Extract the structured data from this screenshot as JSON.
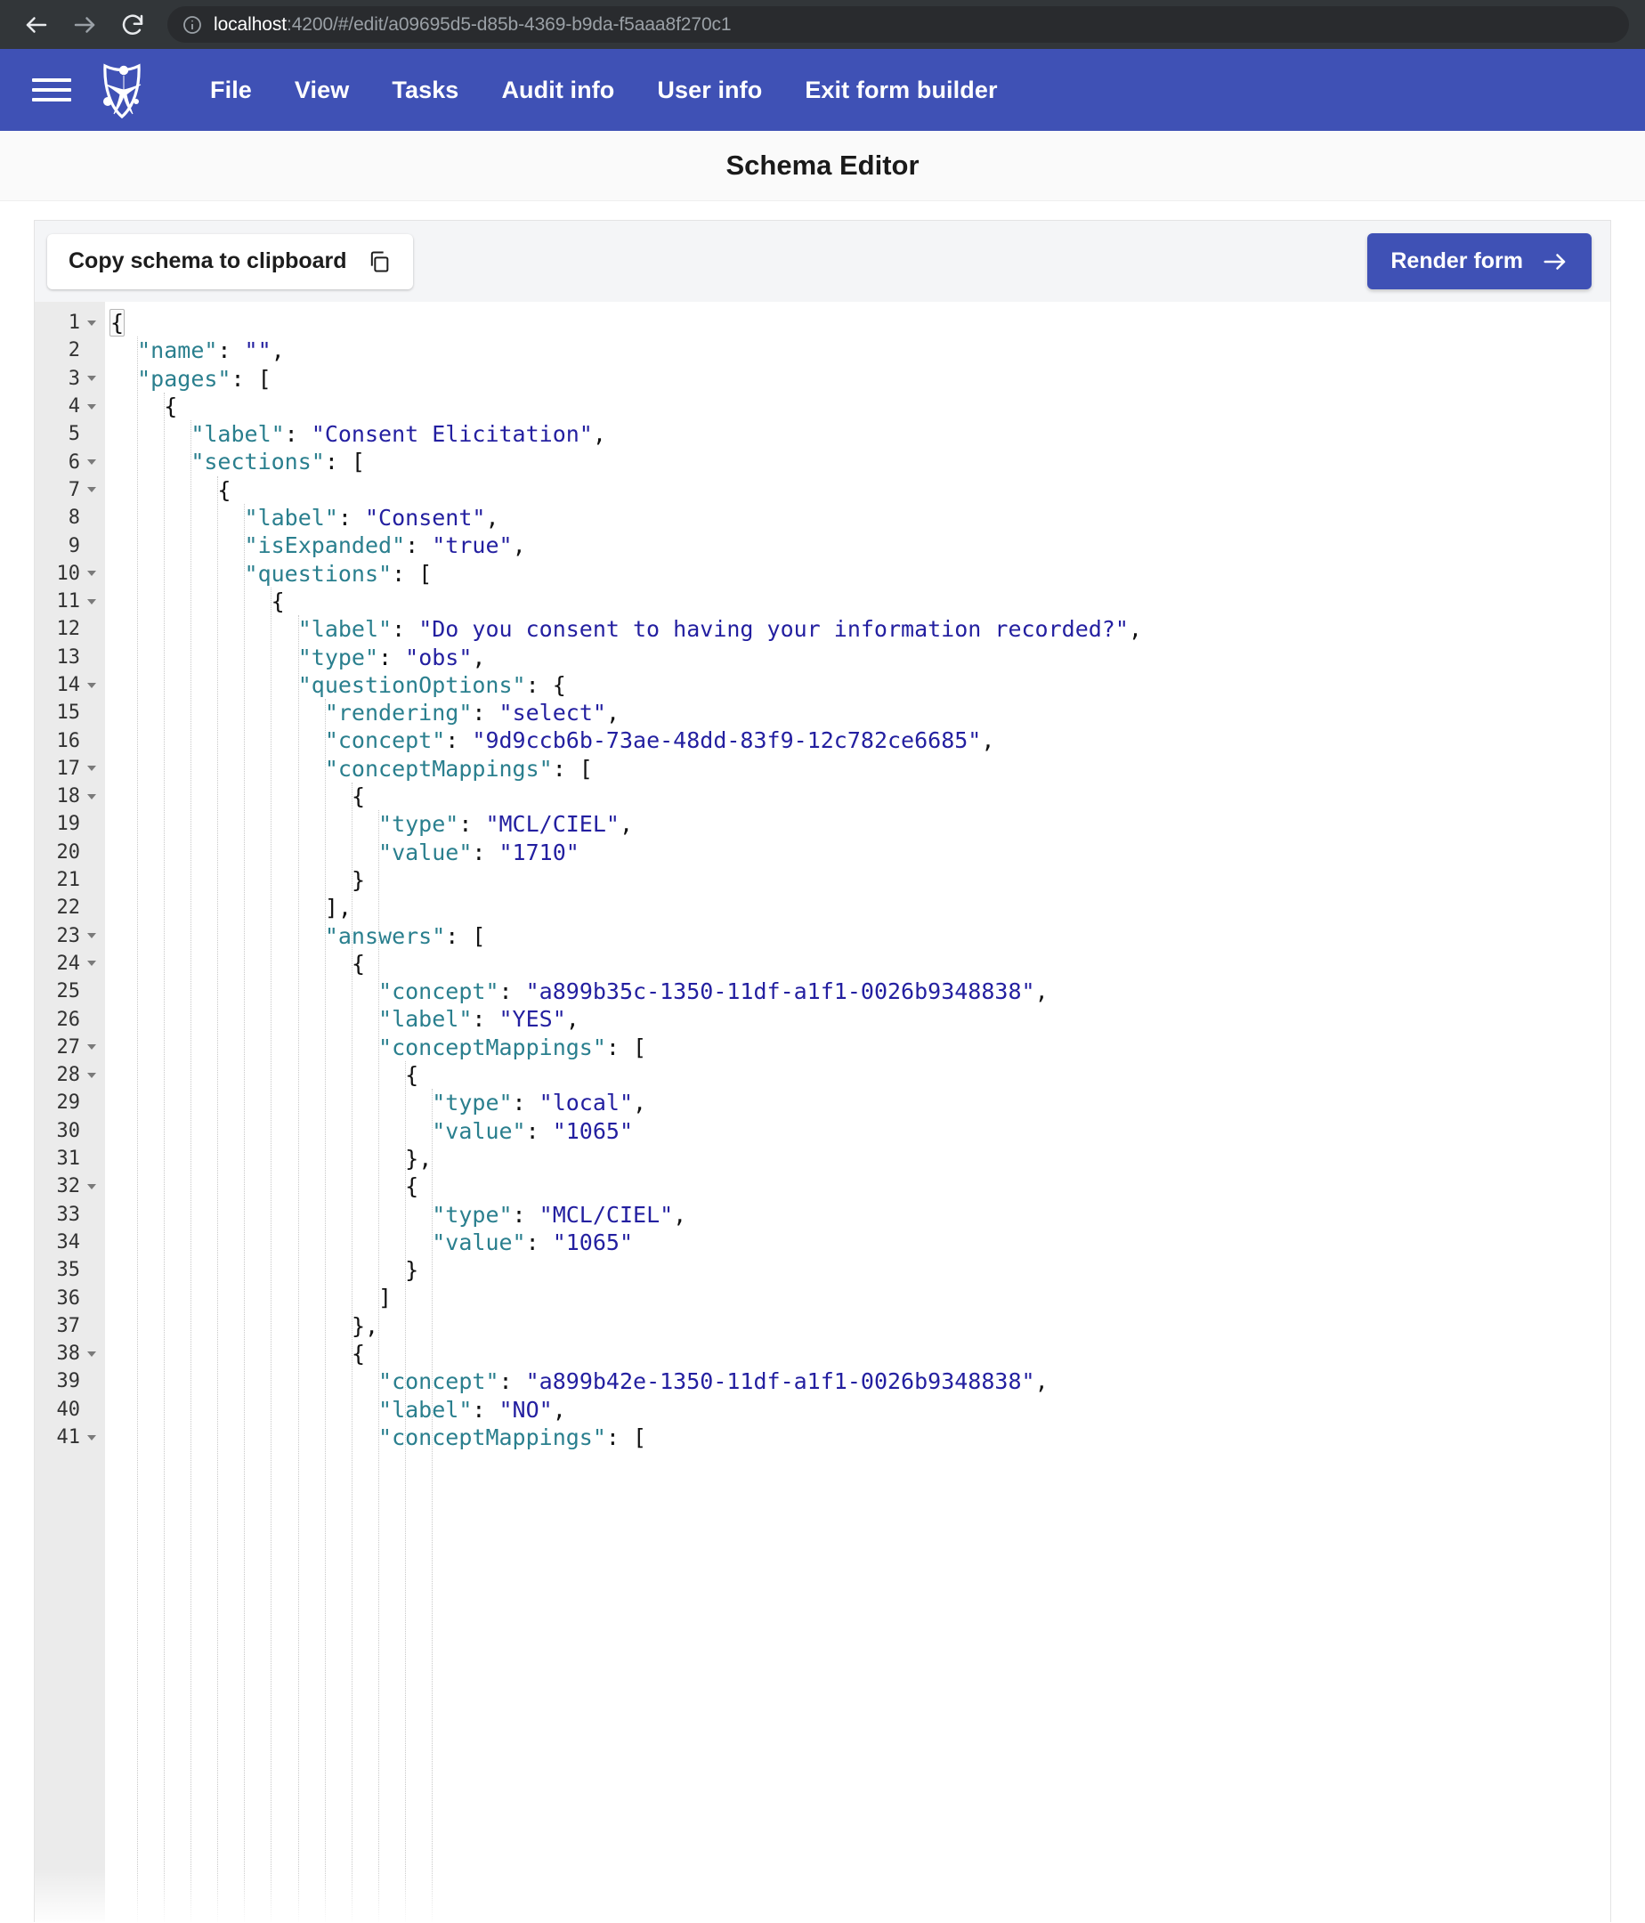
{
  "browser": {
    "back_icon": "back-arrow-icon",
    "forward_icon": "forward-arrow-icon",
    "reload_icon": "reload-icon",
    "info_icon": "site-info-icon",
    "url_host": "localhost",
    "url_path": ":4200/#/edit/a09695d5-d85b-4369-b9da-f5aaa8f270c1"
  },
  "app_nav": {
    "brand": "openmrs-logo",
    "menu_icon": "hamburger-menu-icon",
    "links": [
      {
        "label": "File"
      },
      {
        "label": "View"
      },
      {
        "label": "Tasks"
      },
      {
        "label": "Audit info"
      },
      {
        "label": "User info"
      },
      {
        "label": "Exit form builder"
      }
    ],
    "accent_color": "#3f51b5"
  },
  "header": {
    "title": "Schema Editor"
  },
  "toolbar": {
    "copy_label": "Copy schema to clipboard",
    "copy_icon": "copy-icon",
    "render_label": "Render form",
    "render_icon": "arrow-right-icon"
  },
  "editor": {
    "language": "json",
    "first_visible_line": 1,
    "last_visible_line": 41,
    "colors": {
      "key": "#2a7f8e",
      "string": "#231fa0",
      "punctuation": "#111111",
      "gutter_bg": "#ebebeb",
      "editor_bg": "#ffffff"
    },
    "lines": [
      {
        "n": 1,
        "fold": true,
        "indent": 0,
        "tokens": [
          {
            "t": "punct",
            "v": "{"
          }
        ]
      },
      {
        "n": 2,
        "fold": false,
        "indent": 1,
        "tokens": [
          {
            "t": "key",
            "v": "\"name\""
          },
          {
            "t": "punct",
            "v": ": "
          },
          {
            "t": "str",
            "v": "\"\""
          },
          {
            "t": "punct",
            "v": ","
          }
        ]
      },
      {
        "n": 3,
        "fold": true,
        "indent": 1,
        "tokens": [
          {
            "t": "key",
            "v": "\"pages\""
          },
          {
            "t": "punct",
            "v": ": ["
          }
        ]
      },
      {
        "n": 4,
        "fold": true,
        "indent": 2,
        "tokens": [
          {
            "t": "punct",
            "v": "{"
          }
        ]
      },
      {
        "n": 5,
        "fold": false,
        "indent": 3,
        "tokens": [
          {
            "t": "key",
            "v": "\"label\""
          },
          {
            "t": "punct",
            "v": ": "
          },
          {
            "t": "str",
            "v": "\"Consent Elicitation\""
          },
          {
            "t": "punct",
            "v": ","
          }
        ]
      },
      {
        "n": 6,
        "fold": true,
        "indent": 3,
        "tokens": [
          {
            "t": "key",
            "v": "\"sections\""
          },
          {
            "t": "punct",
            "v": ": ["
          }
        ]
      },
      {
        "n": 7,
        "fold": true,
        "indent": 4,
        "tokens": [
          {
            "t": "punct",
            "v": "{"
          }
        ]
      },
      {
        "n": 8,
        "fold": false,
        "indent": 5,
        "tokens": [
          {
            "t": "key",
            "v": "\"label\""
          },
          {
            "t": "punct",
            "v": ": "
          },
          {
            "t": "str",
            "v": "\"Consent\""
          },
          {
            "t": "punct",
            "v": ","
          }
        ]
      },
      {
        "n": 9,
        "fold": false,
        "indent": 5,
        "tokens": [
          {
            "t": "key",
            "v": "\"isExpanded\""
          },
          {
            "t": "punct",
            "v": ": "
          },
          {
            "t": "str",
            "v": "\"true\""
          },
          {
            "t": "punct",
            "v": ","
          }
        ]
      },
      {
        "n": 10,
        "fold": true,
        "indent": 5,
        "tokens": [
          {
            "t": "key",
            "v": "\"questions\""
          },
          {
            "t": "punct",
            "v": ": ["
          }
        ]
      },
      {
        "n": 11,
        "fold": true,
        "indent": 6,
        "tokens": [
          {
            "t": "punct",
            "v": "{"
          }
        ]
      },
      {
        "n": 12,
        "fold": false,
        "indent": 7,
        "tokens": [
          {
            "t": "key",
            "v": "\"label\""
          },
          {
            "t": "punct",
            "v": ": "
          },
          {
            "t": "str",
            "v": "\"Do you consent to having your information recorded?\""
          },
          {
            "t": "punct",
            "v": ","
          }
        ]
      },
      {
        "n": 13,
        "fold": false,
        "indent": 7,
        "tokens": [
          {
            "t": "key",
            "v": "\"type\""
          },
          {
            "t": "punct",
            "v": ": "
          },
          {
            "t": "str",
            "v": "\"obs\""
          },
          {
            "t": "punct",
            "v": ","
          }
        ]
      },
      {
        "n": 14,
        "fold": true,
        "indent": 7,
        "tokens": [
          {
            "t": "key",
            "v": "\"questionOptions\""
          },
          {
            "t": "punct",
            "v": ": {"
          }
        ]
      },
      {
        "n": 15,
        "fold": false,
        "indent": 8,
        "tokens": [
          {
            "t": "key",
            "v": "\"rendering\""
          },
          {
            "t": "punct",
            "v": ": "
          },
          {
            "t": "str",
            "v": "\"select\""
          },
          {
            "t": "punct",
            "v": ","
          }
        ]
      },
      {
        "n": 16,
        "fold": false,
        "indent": 8,
        "tokens": [
          {
            "t": "key",
            "v": "\"concept\""
          },
          {
            "t": "punct",
            "v": ": "
          },
          {
            "t": "str",
            "v": "\"9d9ccb6b-73ae-48dd-83f9-12c782ce6685\""
          },
          {
            "t": "punct",
            "v": ","
          }
        ]
      },
      {
        "n": 17,
        "fold": true,
        "indent": 8,
        "tokens": [
          {
            "t": "key",
            "v": "\"conceptMappings\""
          },
          {
            "t": "punct",
            "v": ": ["
          }
        ]
      },
      {
        "n": 18,
        "fold": true,
        "indent": 9,
        "tokens": [
          {
            "t": "punct",
            "v": "{"
          }
        ]
      },
      {
        "n": 19,
        "fold": false,
        "indent": 10,
        "tokens": [
          {
            "t": "key",
            "v": "\"type\""
          },
          {
            "t": "punct",
            "v": ": "
          },
          {
            "t": "str",
            "v": "\"MCL/CIEL\""
          },
          {
            "t": "punct",
            "v": ","
          }
        ]
      },
      {
        "n": 20,
        "fold": false,
        "indent": 10,
        "tokens": [
          {
            "t": "key",
            "v": "\"value\""
          },
          {
            "t": "punct",
            "v": ": "
          },
          {
            "t": "str",
            "v": "\"1710\""
          }
        ]
      },
      {
        "n": 21,
        "fold": false,
        "indent": 9,
        "tokens": [
          {
            "t": "punct",
            "v": "}"
          }
        ]
      },
      {
        "n": 22,
        "fold": false,
        "indent": 8,
        "tokens": [
          {
            "t": "punct",
            "v": "],"
          }
        ]
      },
      {
        "n": 23,
        "fold": true,
        "indent": 8,
        "tokens": [
          {
            "t": "key",
            "v": "\"answers\""
          },
          {
            "t": "punct",
            "v": ": ["
          }
        ]
      },
      {
        "n": 24,
        "fold": true,
        "indent": 9,
        "tokens": [
          {
            "t": "punct",
            "v": "{"
          }
        ]
      },
      {
        "n": 25,
        "fold": false,
        "indent": 10,
        "tokens": [
          {
            "t": "key",
            "v": "\"concept\""
          },
          {
            "t": "punct",
            "v": ": "
          },
          {
            "t": "str",
            "v": "\"a899b35c-1350-11df-a1f1-0026b9348838\""
          },
          {
            "t": "punct",
            "v": ","
          }
        ]
      },
      {
        "n": 26,
        "fold": false,
        "indent": 10,
        "tokens": [
          {
            "t": "key",
            "v": "\"label\""
          },
          {
            "t": "punct",
            "v": ": "
          },
          {
            "t": "str",
            "v": "\"YES\""
          },
          {
            "t": "punct",
            "v": ","
          }
        ]
      },
      {
        "n": 27,
        "fold": true,
        "indent": 10,
        "tokens": [
          {
            "t": "key",
            "v": "\"conceptMappings\""
          },
          {
            "t": "punct",
            "v": ": ["
          }
        ]
      },
      {
        "n": 28,
        "fold": true,
        "indent": 11,
        "tokens": [
          {
            "t": "punct",
            "v": "{"
          }
        ]
      },
      {
        "n": 29,
        "fold": false,
        "indent": 12,
        "tokens": [
          {
            "t": "key",
            "v": "\"type\""
          },
          {
            "t": "punct",
            "v": ": "
          },
          {
            "t": "str",
            "v": "\"local\""
          },
          {
            "t": "punct",
            "v": ","
          }
        ]
      },
      {
        "n": 30,
        "fold": false,
        "indent": 12,
        "tokens": [
          {
            "t": "key",
            "v": "\"value\""
          },
          {
            "t": "punct",
            "v": ": "
          },
          {
            "t": "str",
            "v": "\"1065\""
          }
        ]
      },
      {
        "n": 31,
        "fold": false,
        "indent": 11,
        "tokens": [
          {
            "t": "punct",
            "v": "},"
          }
        ]
      },
      {
        "n": 32,
        "fold": true,
        "indent": 11,
        "tokens": [
          {
            "t": "punct",
            "v": "{"
          }
        ]
      },
      {
        "n": 33,
        "fold": false,
        "indent": 12,
        "tokens": [
          {
            "t": "key",
            "v": "\"type\""
          },
          {
            "t": "punct",
            "v": ": "
          },
          {
            "t": "str",
            "v": "\"MCL/CIEL\""
          },
          {
            "t": "punct",
            "v": ","
          }
        ]
      },
      {
        "n": 34,
        "fold": false,
        "indent": 12,
        "tokens": [
          {
            "t": "key",
            "v": "\"value\""
          },
          {
            "t": "punct",
            "v": ": "
          },
          {
            "t": "str",
            "v": "\"1065\""
          }
        ]
      },
      {
        "n": 35,
        "fold": false,
        "indent": 11,
        "tokens": [
          {
            "t": "punct",
            "v": "}"
          }
        ]
      },
      {
        "n": 36,
        "fold": false,
        "indent": 10,
        "tokens": [
          {
            "t": "punct",
            "v": "]"
          }
        ]
      },
      {
        "n": 37,
        "fold": false,
        "indent": 9,
        "tokens": [
          {
            "t": "punct",
            "v": "},"
          }
        ]
      },
      {
        "n": 38,
        "fold": true,
        "indent": 9,
        "tokens": [
          {
            "t": "punct",
            "v": "{"
          }
        ]
      },
      {
        "n": 39,
        "fold": false,
        "indent": 10,
        "tokens": [
          {
            "t": "key",
            "v": "\"concept\""
          },
          {
            "t": "punct",
            "v": ": "
          },
          {
            "t": "str",
            "v": "\"a899b42e-1350-11df-a1f1-0026b9348838\""
          },
          {
            "t": "punct",
            "v": ","
          }
        ]
      },
      {
        "n": 40,
        "fold": false,
        "indent": 10,
        "tokens": [
          {
            "t": "key",
            "v": "\"label\""
          },
          {
            "t": "punct",
            "v": ": "
          },
          {
            "t": "str",
            "v": "\"NO\""
          },
          {
            "t": "punct",
            "v": ","
          }
        ]
      },
      {
        "n": 41,
        "fold": true,
        "indent": 10,
        "tokens": [
          {
            "t": "key",
            "v": "\"conceptMappings\""
          },
          {
            "t": "punct",
            "v": ": ["
          }
        ]
      }
    ]
  }
}
